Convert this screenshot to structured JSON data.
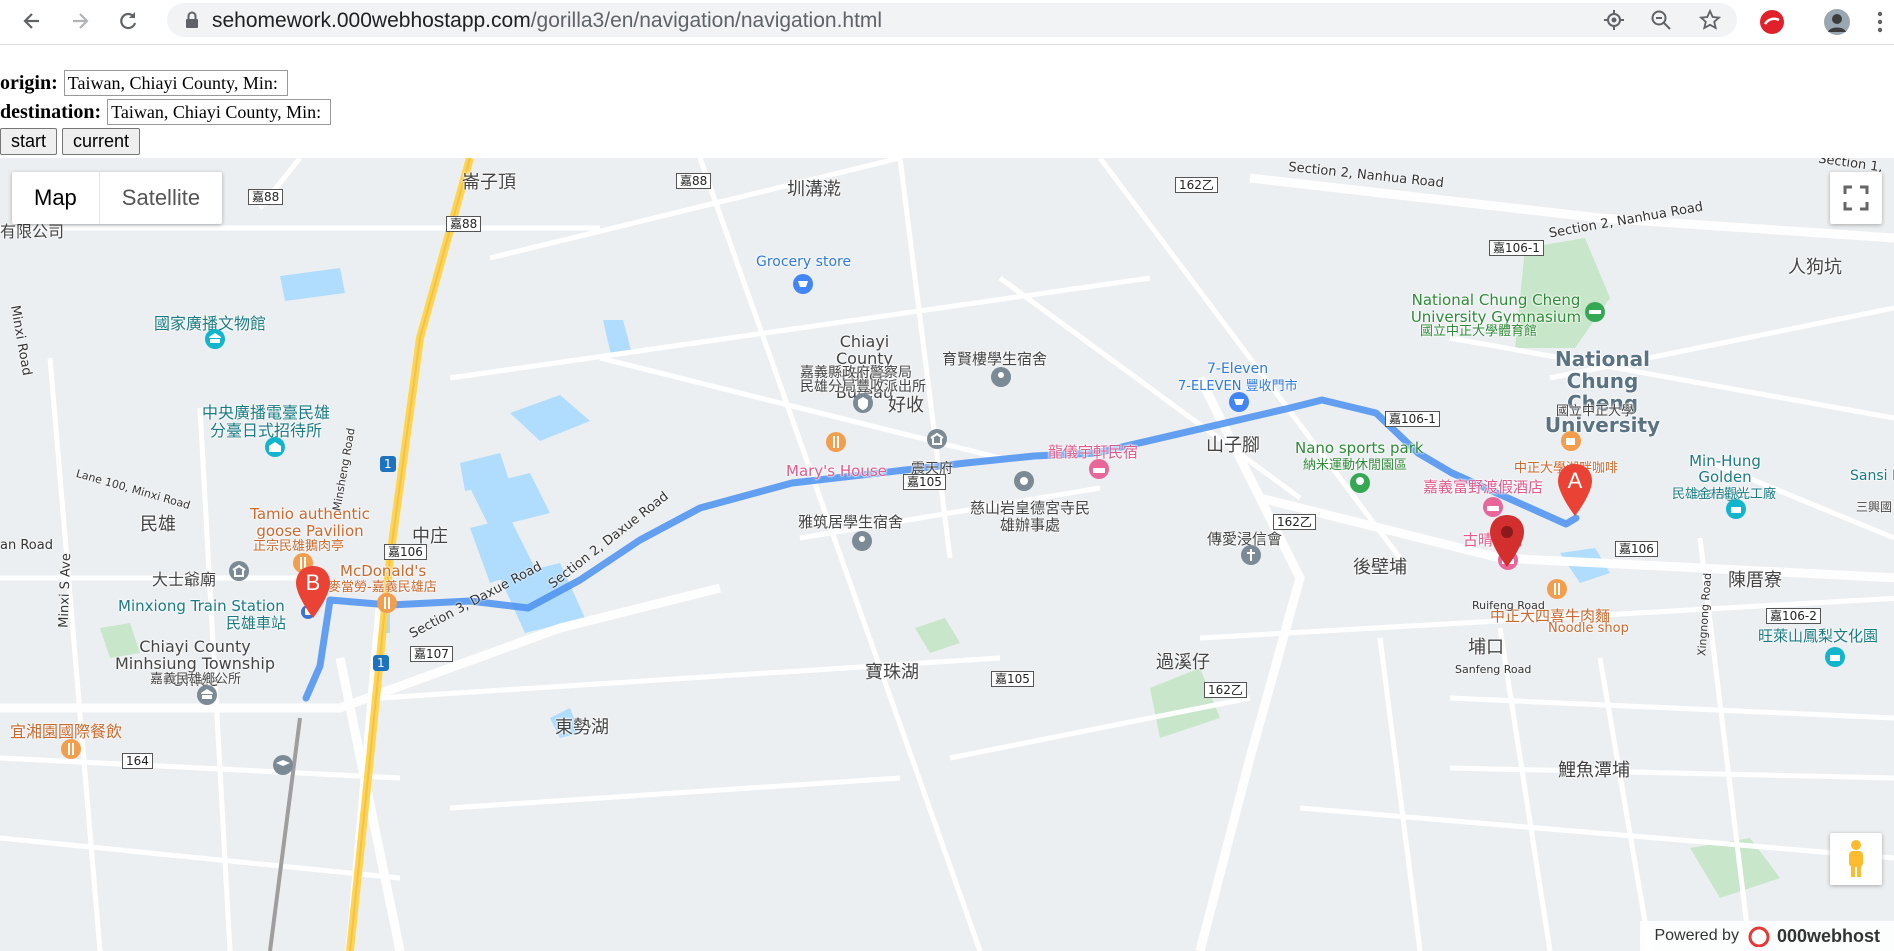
{
  "browser": {
    "url_host": "sehomework.000webhostapp.com",
    "url_path": "/gorilla3/en/navigation/navigation.html",
    "icons": [
      "back-icon",
      "forward-icon",
      "reload-icon",
      "lock-icon",
      "location-icon",
      "zoom-icon",
      "star-icon",
      "extension-icon",
      "profile-icon",
      "menu-icon"
    ]
  },
  "form": {
    "origin_label": "origin:",
    "origin_value": "Taiwan, Chiayi County, Min:",
    "destination_label": "destination:",
    "destination_value": "Taiwan, Chiayi County, Min:",
    "start_label": "start",
    "current_label": "current"
  },
  "map": {
    "map_type_active": "Map",
    "map_type_inactive": "Satellite",
    "marker_a": "A",
    "marker_b": "B",
    "powered_by": "Powered by",
    "powered_brand": "000webhost",
    "route_color": "#4a90f0",
    "labels": {
      "l1": "崙子頂",
      "l2": "圳溝漧",
      "l3": "Section 2, Nanhua Road",
      "l4": "Section 2, Nanhua Road",
      "l5": "人狗坑",
      "l6": "Grocery store",
      "l7": "National Chung Cheng University Gymnasium",
      "l8": "國立中正大學體育館",
      "l9": "National Chung Cheng University",
      "l10": "國立中正大學",
      "l11": "國家廣播文物館",
      "l12": "Chiayi County Police Bureau",
      "l13": "嘉義縣政府警察局",
      "l14": "民雄分局豐收派出所",
      "l15": "育賢樓學生宿舍",
      "l16": "好收",
      "l17": "7-Eleven",
      "l18": "7-ELEVEN 豐收門市",
      "l19": "中央廣播電臺民雄分臺日式招待所",
      "l20": "山子腳",
      "l21": "Nano sports park",
      "l22": "納米運動休閒園區",
      "l23": "中正大學湖畔咖啡",
      "l24": "Min-Hung Golden orange...",
      "l25": "民雄金桔觀光工廠",
      "l26": "龍儀宇軒民宿",
      "l27": "Mary's House",
      "l28": "震天府",
      "l29": "嘉義富野渡假酒店",
      "l30": "民雄",
      "l31": "Tamio authentic goose Pavilion",
      "l32": "正宗民雄鵝肉亭",
      "l33": "中庄",
      "l34": "雅筑居學生宿舍",
      "l35": "慈山岩皇德宮寺民雄辦事處",
      "l36": "傳愛浸信會",
      "l37": "古晴民宿",
      "l38": "後壁埔",
      "l39": "陳厝寮",
      "l40": "大士爺廟",
      "l41": "McDonald's",
      "l42": "麥當勞-嘉義民雄店",
      "l43": "Minxiong Train Station",
      "l44": "民雄車站",
      "l45": "Section 2, Daxue Road",
      "l46": "Section 3, Daxue Road",
      "l47": "Chiayi County Minhsiung Township Office",
      "l48": "嘉義民雄鄉公所",
      "l49": "寶珠湖",
      "l50": "過溪仔",
      "l51": "埔口",
      "l52": "中正大四喜牛肉麵",
      "l53": "Noodle shop",
      "l54": "旺萊山鳳梨文化園",
      "l55": "宜湘園國際餐飲",
      "l56": "東勢湖",
      "l57": "鯉魚潭埔",
      "l58": "Lane 100, Minxi Road",
      "l59": "Minsheng Road",
      "l60": "Minxi Road",
      "l61": "Minxi S Ave",
      "l62": "Ruifeng Road",
      "l63": "Sanfeng Road",
      "l64": "Xingnong Road",
      "l65": "Section 1,",
      "l66": "有限公司",
      "l67": "Sansi Elementary",
      "l68": "三興國",
      "l69": "an Road"
    },
    "shields": {
      "s1": "嘉88",
      "s2": "嘉88",
      "s3": "嘉88",
      "s4": "162乙",
      "s5": "嘉106-1",
      "s6": "嘉106-1",
      "s7": "嘉105",
      "s8": "162乙",
      "s9": "嘉106",
      "s10": "嘉106",
      "s11": "嘉107",
      "s12": "嘉105",
      "s13": "162乙",
      "s14": "嘉106-2",
      "s15": "164",
      "s16": "1",
      "s17": "1"
    }
  }
}
